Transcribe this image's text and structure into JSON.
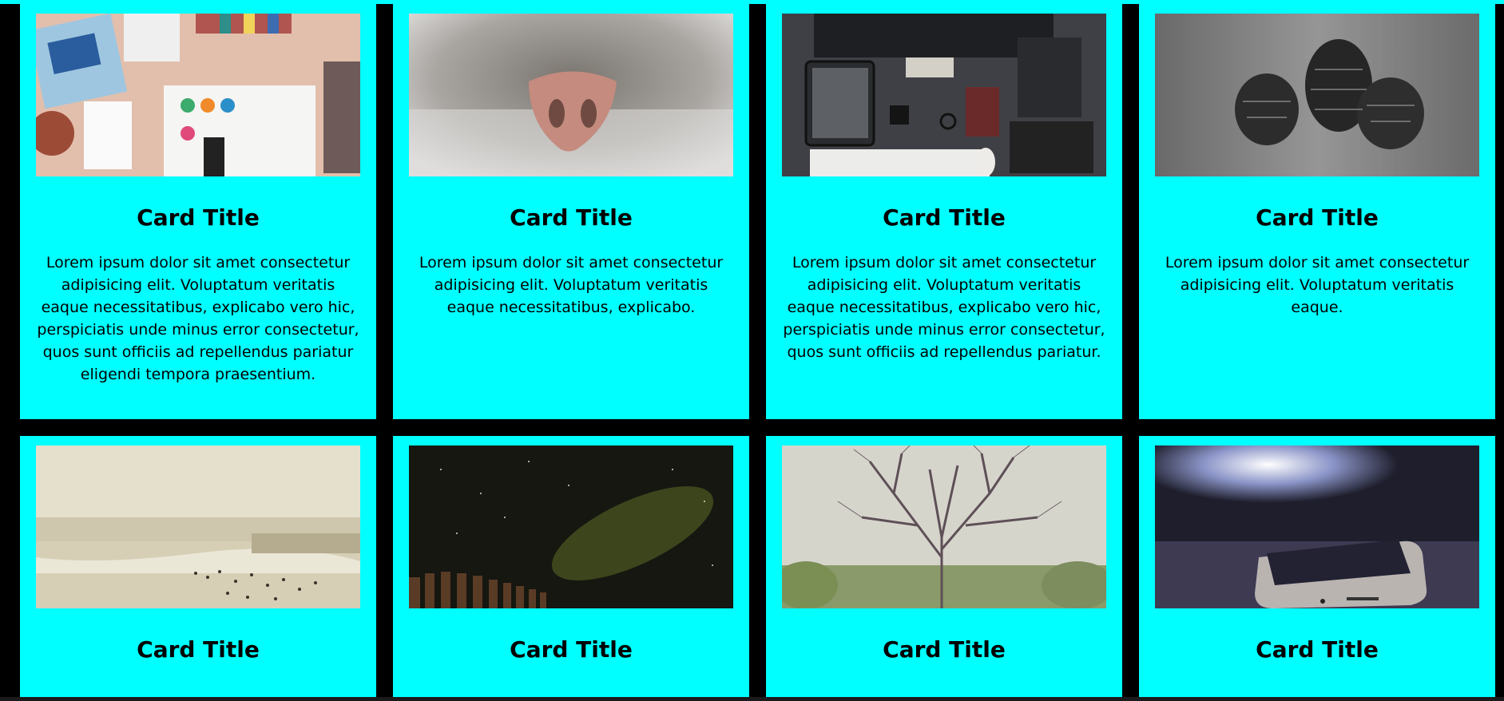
{
  "colors": {
    "card_bg": "#00ffff",
    "page_bg": "#000000"
  },
  "cards": [
    {
      "image": "desk-flatlay-photo",
      "title": "Card Title",
      "text": "Lorem ipsum dolor sit amet consectetur adipisicing elit. Voluptatum veritatis eaque necessitatibus, explicabo vero hic, perspiciatis unde minus error consectetur, quos sunt officiis ad repellendus pariatur eligendi tempora praesentium."
    },
    {
      "image": "cat-nose-photo",
      "title": "Card Title",
      "text": "Lorem ipsum dolor sit amet consectetur adipisicing elit. Voluptatum veritatis eaque necessitatibus, explicabo."
    },
    {
      "image": "dark-desk-setup-photo",
      "title": "Card Title",
      "text": "Lorem ipsum dolor sit amet consectetur adipisicing elit. Voluptatum veritatis eaque necessitatibus, explicabo vero hic, perspiciatis unde minus error consectetur, quos sunt officiis ad repellendus pariatur."
    },
    {
      "image": "pine-cones-photo",
      "title": "Card Title",
      "text": "Lorem ipsum dolor sit amet consectetur adipisicing elit. Voluptatum veritatis eaque."
    },
    {
      "image": "beach-photo",
      "title": "Card Title",
      "text": ""
    },
    {
      "image": "night-sky-photo",
      "title": "Card Title",
      "text": ""
    },
    {
      "image": "bare-tree-photo",
      "title": "Card Title",
      "text": ""
    },
    {
      "image": "smartphone-photo",
      "title": "Card Title",
      "text": ""
    }
  ]
}
